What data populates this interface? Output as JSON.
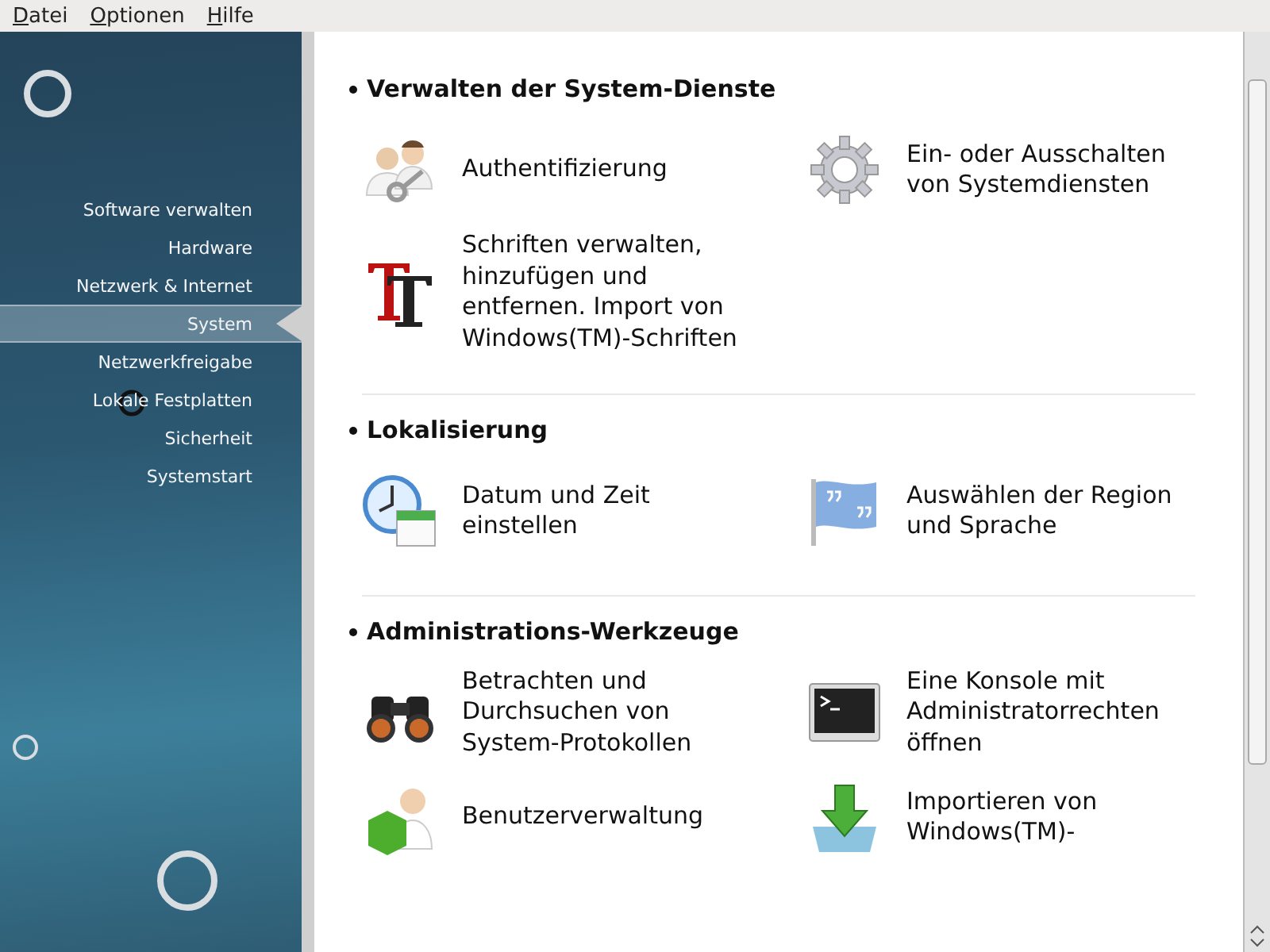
{
  "menu_bar": [
    {
      "label": "Datei"
    },
    {
      "label": "Optionen"
    },
    {
      "label": "Hilfe"
    }
  ],
  "sidebar": {
    "items": [
      {
        "label": "Software verwalten",
        "selected": false
      },
      {
        "label": "Hardware",
        "selected": false
      },
      {
        "label": "Netzwerk & Internet",
        "selected": false
      },
      {
        "label": "System",
        "selected": true
      },
      {
        "label": "Netzwerkfreigabe",
        "selected": false
      },
      {
        "label": "Lokale Festplatten",
        "selected": false
      },
      {
        "label": "Sicherheit",
        "selected": false
      },
      {
        "label": "Systemstart",
        "selected": false
      }
    ]
  },
  "sections": [
    {
      "title": "Verwalten der System-Dienste",
      "items": [
        {
          "label": "Authentifizierung"
        },
        {
          "label": "Ein- oder Ausschalten von Systemdiensten"
        },
        {
          "label": "Schriften verwalten, hinzufügen und entfernen. Import von Windows(TM)-Schriften"
        }
      ]
    },
    {
      "title": "Lokalisierung",
      "items": [
        {
          "label": "Datum und Zeit einstellen"
        },
        {
          "label": "Auswählen der Region und Sprache"
        }
      ]
    },
    {
      "title": "Administrations-Werkzeuge",
      "items": [
        {
          "label": "Betrachten und Durchsuchen von System-Protokollen"
        },
        {
          "label": "Eine Konsole mit Administratorrechten öffnen"
        },
        {
          "label": "Benutzerverwaltung"
        },
        {
          "label": "Importieren von Windows(TM)-"
        }
      ]
    }
  ]
}
